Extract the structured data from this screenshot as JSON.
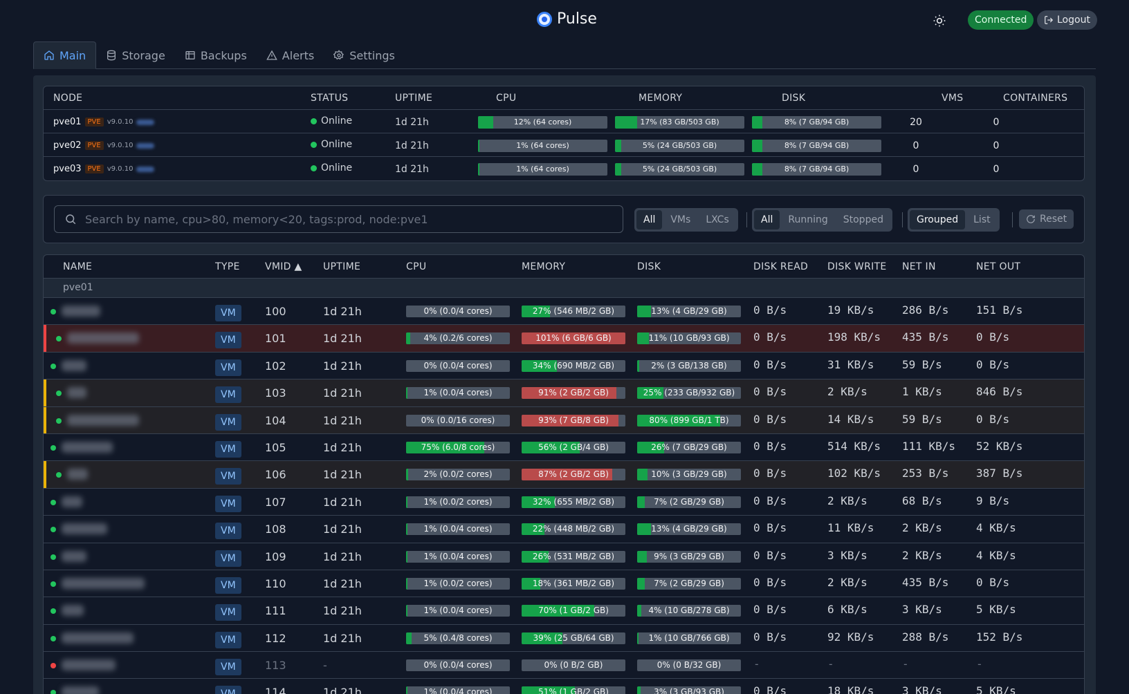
{
  "header": {
    "app_name": "Pulse",
    "connection_status": "Connected",
    "logout_label": "Logout"
  },
  "tabs": [
    {
      "label": "Main",
      "icon": "home-icon",
      "active": true
    },
    {
      "label": "Storage",
      "icon": "database-icon",
      "active": false
    },
    {
      "label": "Backups",
      "icon": "archive-icon",
      "active": false
    },
    {
      "label": "Alerts",
      "icon": "warning-icon",
      "active": false
    },
    {
      "label": "Settings",
      "icon": "gear-icon",
      "active": false
    }
  ],
  "nodes": {
    "columns": {
      "node": "NODE",
      "status": "STATUS",
      "uptime": "UPTIME",
      "cpu": "CPU",
      "memory": "MEMORY",
      "disk": "DISK",
      "vms": "VMS",
      "containers": "CONTAINERS"
    },
    "rows": [
      {
        "name": "pve01",
        "badge": "PVE",
        "version": "v9.0.10",
        "status": "Online",
        "uptime": "1d 21h",
        "cpu_pct": 12,
        "cpu_label": "12% (64 cores)",
        "mem_pct": 17,
        "mem_label": "17% (83 GB/503 GB)",
        "disk_pct": 8,
        "disk_label": "8% (7 GB/94 GB)",
        "vms": "20",
        "containers": "0"
      },
      {
        "name": "pve02",
        "badge": "PVE",
        "version": "v9.0.10",
        "status": "Online",
        "uptime": "1d 21h",
        "cpu_pct": 1,
        "cpu_label": "1% (64 cores)",
        "mem_pct": 5,
        "mem_label": "5% (24 GB/503 GB)",
        "disk_pct": 8,
        "disk_label": "8% (7 GB/94 GB)",
        "vms": "0",
        "containers": "0"
      },
      {
        "name": "pve03",
        "badge": "PVE",
        "version": "v9.0.10",
        "status": "Online",
        "uptime": "1d 21h",
        "cpu_pct": 1,
        "cpu_label": "1% (64 cores)",
        "mem_pct": 5,
        "mem_label": "5% (24 GB/503 GB)",
        "disk_pct": 8,
        "disk_label": "8% (7 GB/94 GB)",
        "vms": "0",
        "containers": "0"
      }
    ]
  },
  "filters": {
    "search_placeholder": "Search by name, cpu>80, memory<20, tags:prod, node:pve1",
    "type_options": [
      "All",
      "VMs",
      "LXCs"
    ],
    "type_selected": "All",
    "status_options": [
      "All",
      "Running",
      "Stopped"
    ],
    "status_selected": "All",
    "view_options": [
      "Grouped",
      "List"
    ],
    "view_selected": "Grouped",
    "reset_label": "Reset"
  },
  "guests": {
    "columns": {
      "name": "NAME",
      "type": "TYPE",
      "vmid": "VMID ▲",
      "uptime": "UPTIME",
      "cpu": "CPU",
      "memory": "MEMORY",
      "disk": "DISK",
      "disk_read": "DISK READ",
      "disk_write": "DISK WRITE",
      "net_in": "NET IN",
      "net_out": "NET OUT"
    },
    "group": "pve01",
    "rows": [
      {
        "highlight": "",
        "running": true,
        "type": "VM",
        "vmid": "100",
        "uptime": "1d 21h",
        "cpu_pct": 0,
        "cpu_label": "0% (0.0/4 cores)",
        "mem_pct": 27,
        "mem_label": "27% (546 MB/2 GB)",
        "disk_pct": 13,
        "disk_label": "13% (4 GB/29 GB)",
        "disk_read": "0 B/s",
        "disk_write": "19 KB/s",
        "net_in": "286 B/s",
        "net_out": "151 B/s"
      },
      {
        "highlight": "crit",
        "running": true,
        "type": "VM",
        "vmid": "101",
        "uptime": "1d 21h",
        "cpu_pct": 4,
        "cpu_label": "4% (0.2/6 cores)",
        "mem_pct": 100,
        "mem_label": "101% (6 GB/6 GB)",
        "mem_red": true,
        "disk_pct": 11,
        "disk_label": "11% (10 GB/93 GB)",
        "disk_read": "0 B/s",
        "disk_write": "198 KB/s",
        "net_in": "435 B/s",
        "net_out": "0 B/s"
      },
      {
        "highlight": "",
        "running": true,
        "type": "VM",
        "vmid": "102",
        "uptime": "1d 21h",
        "cpu_pct": 0,
        "cpu_label": "0% (0.0/4 cores)",
        "mem_pct": 34,
        "mem_label": "34% (690 MB/2 GB)",
        "disk_pct": 2,
        "disk_label": "2% (3 GB/138 GB)",
        "disk_read": "0 B/s",
        "disk_write": "31 KB/s",
        "net_in": "59 B/s",
        "net_out": "0 B/s"
      },
      {
        "highlight": "warn",
        "running": true,
        "type": "VM",
        "vmid": "103",
        "uptime": "1d 21h",
        "cpu_pct": 1,
        "cpu_label": "1% (0.0/4 cores)",
        "mem_pct": 91,
        "mem_label": "91% (2 GB/2 GB)",
        "mem_red": true,
        "disk_pct": 25,
        "disk_label": "25% (233 GB/932 GB)",
        "disk_read": "0 B/s",
        "disk_write": "2 KB/s",
        "net_in": "1 KB/s",
        "net_out": "846 B/s"
      },
      {
        "highlight": "warn",
        "running": true,
        "type": "VM",
        "vmid": "104",
        "uptime": "1d 21h",
        "cpu_pct": 0,
        "cpu_label": "0% (0.0/16 cores)",
        "mem_pct": 93,
        "mem_label": "93% (7 GB/8 GB)",
        "mem_red": true,
        "disk_pct": 80,
        "disk_label": "80% (899 GB/1 TB)",
        "disk_read": "0 B/s",
        "disk_write": "14 KB/s",
        "net_in": "59 B/s",
        "net_out": "0 B/s"
      },
      {
        "highlight": "",
        "running": true,
        "type": "VM",
        "vmid": "105",
        "uptime": "1d 21h",
        "cpu_pct": 75,
        "cpu_label": "75% (6.0/8 cores)",
        "mem_pct": 56,
        "mem_label": "56% (2 GB/4 GB)",
        "disk_pct": 26,
        "disk_label": "26% (7 GB/29 GB)",
        "disk_read": "0 B/s",
        "disk_write": "514 KB/s",
        "net_in": "111 KB/s",
        "net_out": "52 KB/s"
      },
      {
        "highlight": "warn",
        "running": true,
        "type": "VM",
        "vmid": "106",
        "uptime": "1d 21h",
        "cpu_pct": 2,
        "cpu_label": "2% (0.0/2 cores)",
        "mem_pct": 87,
        "mem_label": "87% (2 GB/2 GB)",
        "mem_red": true,
        "disk_pct": 10,
        "disk_label": "10% (3 GB/29 GB)",
        "disk_read": "0 B/s",
        "disk_write": "102 KB/s",
        "net_in": "253 B/s",
        "net_out": "387 B/s"
      },
      {
        "highlight": "",
        "running": true,
        "type": "VM",
        "vmid": "107",
        "uptime": "1d 21h",
        "cpu_pct": 1,
        "cpu_label": "1% (0.0/2 cores)",
        "mem_pct": 32,
        "mem_label": "32% (655 MB/2 GB)",
        "disk_pct": 7,
        "disk_label": "7% (2 GB/29 GB)",
        "disk_read": "0 B/s",
        "disk_write": "2 KB/s",
        "net_in": "68 B/s",
        "net_out": "9 B/s"
      },
      {
        "highlight": "",
        "running": true,
        "type": "VM",
        "vmid": "108",
        "uptime": "1d 21h",
        "cpu_pct": 1,
        "cpu_label": "1% (0.0/4 cores)",
        "mem_pct": 22,
        "mem_label": "22% (448 MB/2 GB)",
        "disk_pct": 13,
        "disk_label": "13% (4 GB/29 GB)",
        "disk_read": "0 B/s",
        "disk_write": "11 KB/s",
        "net_in": "2 KB/s",
        "net_out": "4 KB/s"
      },
      {
        "highlight": "",
        "running": true,
        "type": "VM",
        "vmid": "109",
        "uptime": "1d 21h",
        "cpu_pct": 1,
        "cpu_label": "1% (0.0/4 cores)",
        "mem_pct": 26,
        "mem_label": "26% (531 MB/2 GB)",
        "disk_pct": 9,
        "disk_label": "9% (3 GB/29 GB)",
        "disk_read": "0 B/s",
        "disk_write": "3 KB/s",
        "net_in": "2 KB/s",
        "net_out": "4 KB/s"
      },
      {
        "highlight": "",
        "running": true,
        "type": "VM",
        "vmid": "110",
        "uptime": "1d 21h",
        "cpu_pct": 1,
        "cpu_label": "1% (0.0/2 cores)",
        "mem_pct": 18,
        "mem_label": "18% (361 MB/2 GB)",
        "disk_pct": 7,
        "disk_label": "7% (2 GB/29 GB)",
        "disk_read": "0 B/s",
        "disk_write": "2 KB/s",
        "net_in": "435 B/s",
        "net_out": "0 B/s"
      },
      {
        "highlight": "",
        "running": true,
        "type": "VM",
        "vmid": "111",
        "uptime": "1d 21h",
        "cpu_pct": 1,
        "cpu_label": "1% (0.0/4 cores)",
        "mem_pct": 70,
        "mem_label": "70% (1 GB/2 GB)",
        "disk_pct": 4,
        "disk_label": "4% (10 GB/278 GB)",
        "disk_read": "0 B/s",
        "disk_write": "6 KB/s",
        "net_in": "3 KB/s",
        "net_out": "5 KB/s"
      },
      {
        "highlight": "",
        "running": true,
        "type": "VM",
        "vmid": "112",
        "uptime": "1d 21h",
        "cpu_pct": 5,
        "cpu_label": "5% (0.4/8 cores)",
        "mem_pct": 39,
        "mem_label": "39% (25 GB/64 GB)",
        "disk_pct": 1,
        "disk_label": "1% (10 GB/766 GB)",
        "disk_read": "0 B/s",
        "disk_write": "92 KB/s",
        "net_in": "288 B/s",
        "net_out": "152 B/s"
      },
      {
        "highlight": "",
        "running": false,
        "type": "VM",
        "vmid": "113",
        "uptime": "-",
        "cpu_pct": 0,
        "cpu_label": "0% (0.0/4 cores)",
        "mem_pct": 0,
        "mem_label": "0% (0 B/2 GB)",
        "disk_pct": 0,
        "disk_label": "0% (0 B/32 GB)",
        "disk_read": "-",
        "disk_write": "-",
        "net_in": "-",
        "net_out": "-"
      },
      {
        "highlight": "",
        "running": true,
        "type": "VM",
        "vmid": "114",
        "uptime": "1d 21h",
        "cpu_pct": 1,
        "cpu_label": "1% (0.0/4 cores)",
        "mem_pct": 51,
        "mem_label": "51% (1 GB/2 GB)",
        "disk_pct": 3,
        "disk_label": "3% (3 GB/93 GB)",
        "disk_read": "0 B/s",
        "disk_write": "18 KB/s",
        "net_in": "3 KB/s",
        "net_out": "5 KB/s"
      }
    ]
  },
  "colors": {
    "accent": "#3b82f6",
    "ok": "#22c55e",
    "bar_fill": "#16a34a",
    "bar_warn": "#b94b4b",
    "crit_row": "#ef4444",
    "warn_row": "#eab308"
  }
}
